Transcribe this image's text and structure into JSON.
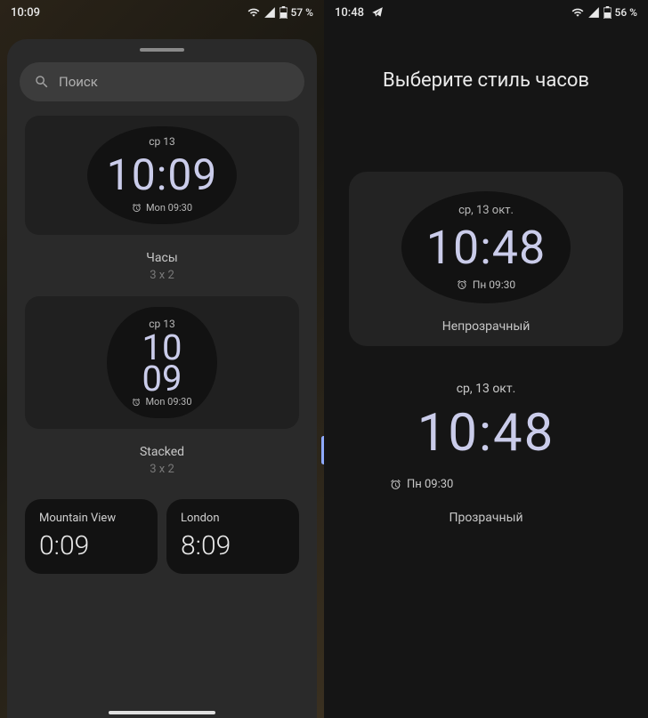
{
  "left": {
    "statusbar": {
      "time": "10:09",
      "battery": "57 %"
    },
    "search_placeholder": "Поиск",
    "widgets": [
      {
        "date": "ср 13",
        "time": "10:09",
        "alarm": "Mon 09:30",
        "title": "Часы",
        "size": "3 x 2"
      },
      {
        "date": "ср 13",
        "time_hh": "10",
        "time_mm": "09",
        "alarm": "Mon 09:30",
        "title": "Stacked",
        "size": "3 x 2"
      }
    ],
    "worldclocks": [
      {
        "city": "Mountain View",
        "time": "0:09"
      },
      {
        "city": "London",
        "time": "8:09"
      }
    ]
  },
  "right": {
    "statusbar": {
      "time": "10:48",
      "battery": "56 %"
    },
    "title": "Выберите стиль часов",
    "styles": [
      {
        "date": "ср, 13 окт.",
        "time": "10:48",
        "alarm": "Пн 09:30",
        "label": "Непрозрачный"
      },
      {
        "date": "ср, 13 окт.",
        "time": "10:48",
        "alarm": "Пн 09:30",
        "label": "Прозрачный"
      }
    ]
  }
}
